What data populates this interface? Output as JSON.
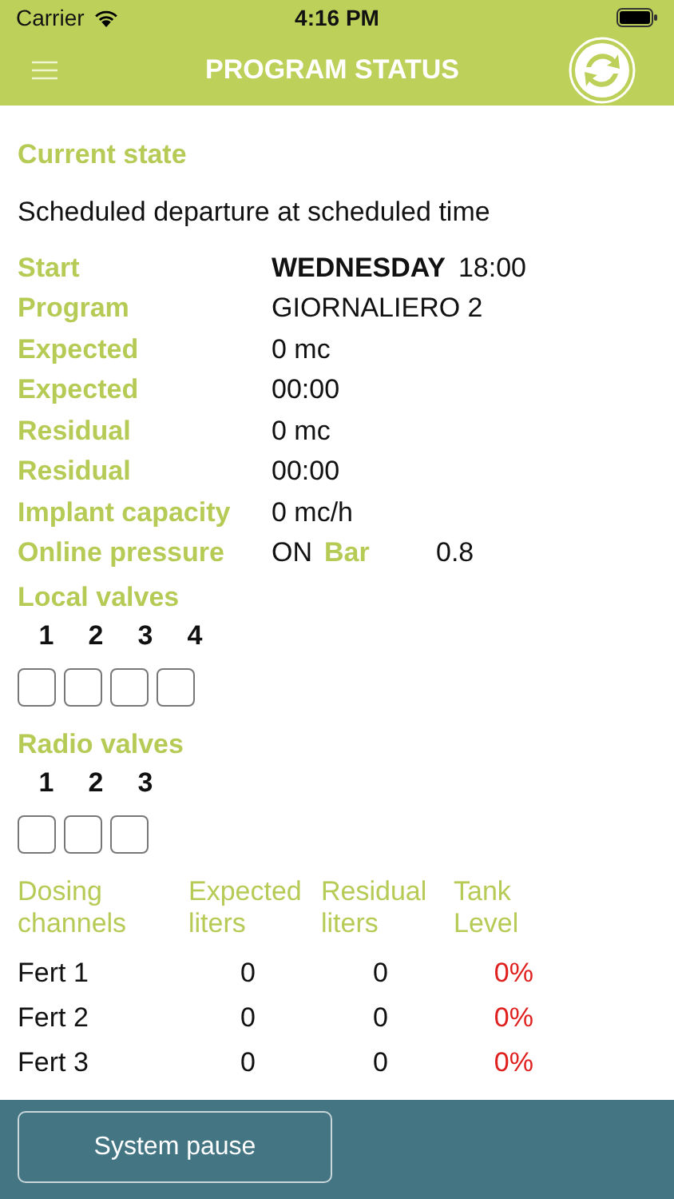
{
  "status_bar": {
    "carrier": "Carrier",
    "time": "4:16 PM"
  },
  "nav": {
    "title": "PROGRAM STATUS"
  },
  "current_state": {
    "title": "Current state",
    "message": "Scheduled departure at scheduled time"
  },
  "fields": [
    {
      "kind": "day_time",
      "label": "Start",
      "value": "WEDNESDAY",
      "time": "18:00"
    },
    {
      "kind": "text",
      "label": "Program",
      "value": "GIORNALIERO 2"
    },
    {
      "kind": "text",
      "label": "Expected",
      "value": "0 mc"
    },
    {
      "kind": "text",
      "label": "Expected",
      "value": "00:00"
    },
    {
      "kind": "text",
      "label": "Residual",
      "value": "0 mc"
    },
    {
      "kind": "text",
      "label": "Residual",
      "value": "00:00"
    },
    {
      "kind": "text",
      "label": "Implant capacity",
      "value": "0 mc/h"
    },
    {
      "kind": "pressure",
      "label": "Online pressure",
      "value": "ON",
      "unit_label": "Bar",
      "reading": "0.8"
    }
  ],
  "valve_groups": [
    {
      "title": "Local valves",
      "valves": [
        {
          "number": "1",
          "checked": false
        },
        {
          "number": "2",
          "checked": false
        },
        {
          "number": "3",
          "checked": false
        },
        {
          "number": "4",
          "checked": false
        }
      ]
    },
    {
      "title": "Radio valves",
      "valves": [
        {
          "number": "1",
          "checked": false
        },
        {
          "number": "2",
          "checked": false
        },
        {
          "number": "3",
          "checked": false
        }
      ]
    }
  ],
  "dosing": {
    "columns": [
      [
        "Dosing",
        "channels"
      ],
      [
        "Expected",
        "liters"
      ],
      [
        "Residual",
        "liters"
      ],
      [
        "Tank",
        "Level"
      ]
    ],
    "rows": [
      {
        "name": "Fert 1",
        "expected": "0",
        "residual": "0",
        "tank_level": "0%"
      },
      {
        "name": "Fert 2",
        "expected": "0",
        "residual": "0",
        "tank_level": "0%"
      },
      {
        "name": "Fert 3",
        "expected": "0",
        "residual": "0",
        "tank_level": "0%"
      }
    ]
  },
  "pause_button": "System pause"
}
